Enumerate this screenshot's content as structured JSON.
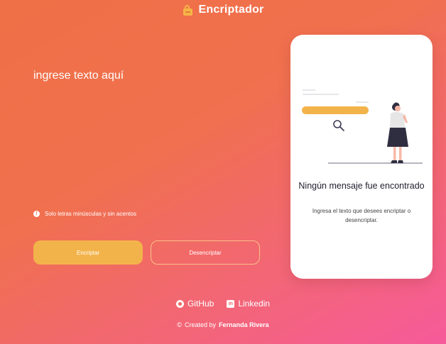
{
  "header": {
    "logo_icon": "lock-icon",
    "title": "Encriptador"
  },
  "input": {
    "placeholder": "ingrese texto aquí",
    "value": ""
  },
  "hint": {
    "icon": "info-icon",
    "text": "Solo letras minúsculas y sin acentos"
  },
  "buttons": {
    "encrypt_label": "Encriptar",
    "decrypt_label": "Desencriptar"
  },
  "output_card": {
    "title": "Ningún mensaje fue encontrado",
    "description": "Ingresa el texto que desees encriptar o desencriptar."
  },
  "footer": {
    "github_label": "GitHub",
    "linkedin_label": "Linkedin",
    "credit_symbol": "©",
    "credit_prefix": "Created by",
    "credit_name": "Fernanda Rivera"
  },
  "colors": {
    "background_start": "#ef7046",
    "background_end": "#f65a9a",
    "primary_button": "#f3b34b",
    "card_background": "#ffffff"
  }
}
